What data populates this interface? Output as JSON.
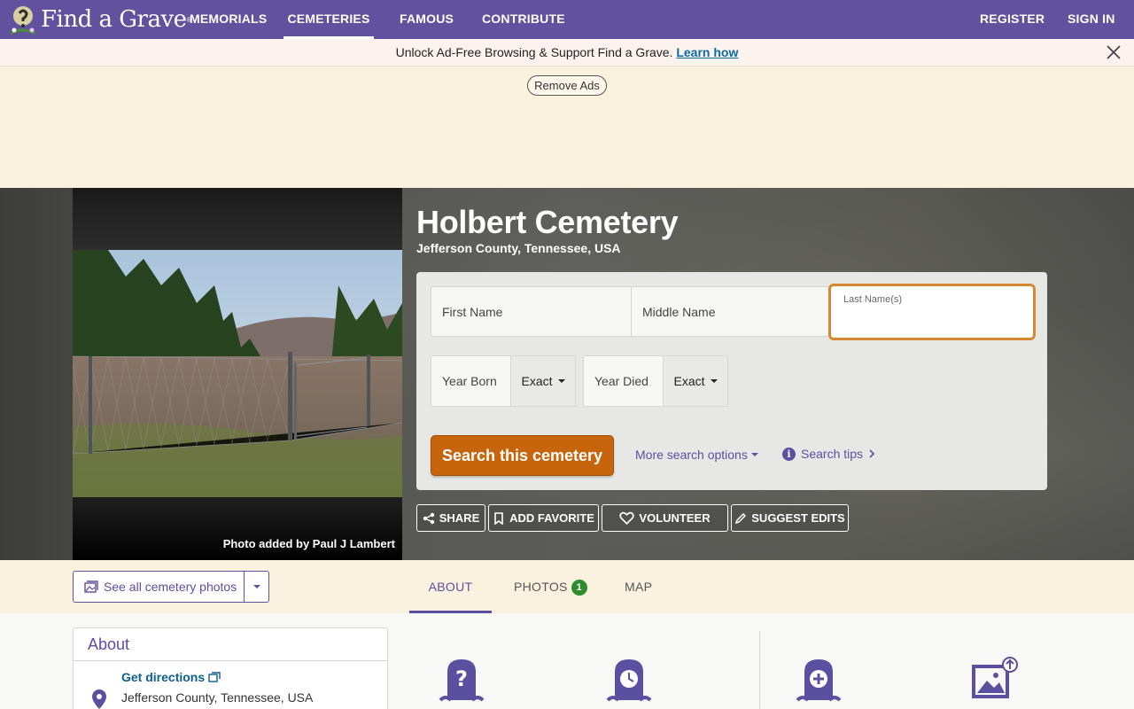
{
  "nav": {
    "logo": "Find a Grave",
    "logo_reg": "®",
    "links": [
      "MEMORIALS",
      "CEMETERIES",
      "FAMOUS",
      "CONTRIBUTE"
    ],
    "register": "REGISTER",
    "sign_in": "SIGN IN"
  },
  "promo": {
    "text": "Unlock Ad-Free Browsing & Support Find a Grave.",
    "link": "Learn how"
  },
  "ads": {
    "remove_label": "Remove Ads"
  },
  "cemetery": {
    "title": "Holbert Cemetery",
    "location": "Jefferson County, Tennessee, USA",
    "photo_credit": "Photo added by Paul J Lambert"
  },
  "search": {
    "first_name": "First Name",
    "middle_name": "Middle Name",
    "last_name": "Last Name(s)",
    "year_born": "Year Born",
    "year_died": "Year Died",
    "exact_born": "Exact",
    "exact_died": "Exact",
    "submit": "Search this cemetery",
    "more_options": "More search options",
    "tips": "Search tips"
  },
  "actions": {
    "share": "SHARE",
    "add_favorite": "ADD FAVORITE",
    "volunteer": "VOLUNTEER",
    "suggest_edits": "SUGGEST EDITS"
  },
  "tabs": {
    "see_photos": "See all cemetery photos",
    "about": "ABOUT",
    "photos": "PHOTOS",
    "photos_count": "1",
    "map": "MAP"
  },
  "about": {
    "heading": "About",
    "directions": "Get directions",
    "location": "Jefferson County, Tennessee, USA"
  },
  "colors": {
    "nav": "#62519f",
    "accent": "#5b4fa0",
    "search_button": "#c7650d",
    "focus_border": "#d58830"
  }
}
